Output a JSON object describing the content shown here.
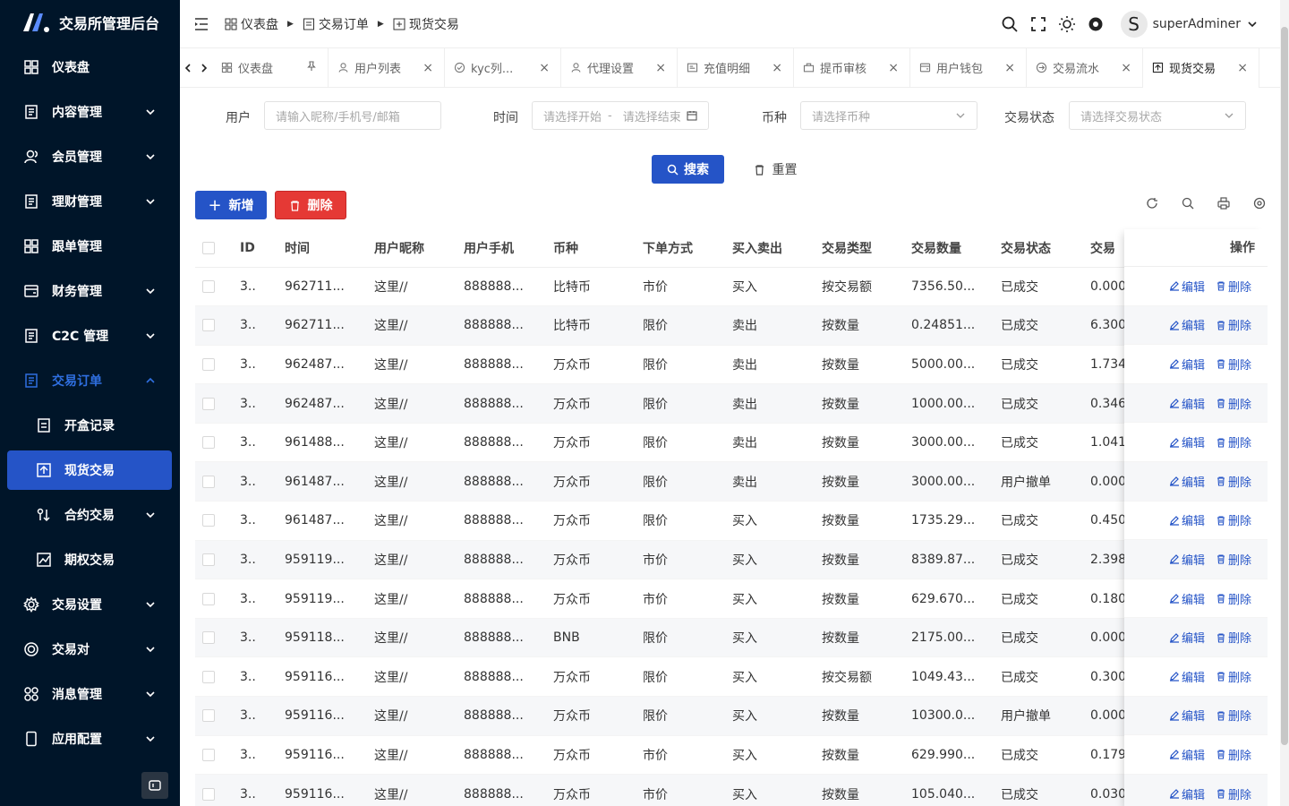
{
  "app": {
    "title": "交易所管理后台"
  },
  "sidebar": {
    "items": [
      {
        "label": "仪表盘",
        "icon": "dashboard-icon",
        "has_children": false
      },
      {
        "label": "内容管理",
        "icon": "document-icon",
        "has_children": true
      },
      {
        "label": "会员管理",
        "icon": "users-icon",
        "has_children": true
      },
      {
        "label": "理财管理",
        "icon": "document-icon",
        "has_children": true
      },
      {
        "label": "跟单管理",
        "icon": "grid-icon",
        "has_children": false
      },
      {
        "label": "财务管理",
        "icon": "wallet-icon",
        "has_children": true
      },
      {
        "label": "C2C 管理",
        "icon": "document-icon",
        "has_children": true
      },
      {
        "label": "交易订单",
        "icon": "order-icon",
        "has_children": true,
        "open": true
      },
      {
        "label": "开盒记录",
        "icon": "list-icon",
        "sub": true
      },
      {
        "label": "现货交易",
        "icon": "spot-icon",
        "sub": true,
        "active": true
      },
      {
        "label": "合约交易",
        "icon": "contract-icon",
        "sub": true,
        "has_children": true
      },
      {
        "label": "期权交易",
        "icon": "chart-icon",
        "sub": true
      },
      {
        "label": "交易设置",
        "icon": "gear-icon",
        "has_children": true
      },
      {
        "label": "交易对",
        "icon": "coin-icon",
        "has_children": true
      },
      {
        "label": "消息管理",
        "icon": "apps-icon",
        "has_children": true
      },
      {
        "label": "应用配置",
        "icon": "phone-icon",
        "has_children": true
      }
    ]
  },
  "breadcrumb": [
    "仪表盘",
    "交易订单",
    "现货交易"
  ],
  "header": {
    "user_initial": "S",
    "user_name": "superAdminer"
  },
  "tabs": [
    {
      "label": "仪表盘",
      "icon": "dashboard-icon",
      "pinned": true
    },
    {
      "label": "用户列表",
      "icon": "user-icon"
    },
    {
      "label": "kyc列...",
      "icon": "check-circle-icon"
    },
    {
      "label": "代理设置",
      "icon": "user-icon"
    },
    {
      "label": "充值明细",
      "icon": "receipt-icon"
    },
    {
      "label": "提币审核",
      "icon": "audit-icon"
    },
    {
      "label": "用户钱包",
      "icon": "wallet-icon"
    },
    {
      "label": "交易流水",
      "icon": "flow-icon"
    },
    {
      "label": "现货交易",
      "icon": "spot-icon",
      "active": true
    }
  ],
  "filters": {
    "user_label": "用户",
    "user_placeholder": "请输入昵称/手机号/邮箱",
    "time_label": "时间",
    "time_start_placeholder": "请选择开始",
    "time_sep": "-",
    "time_end_placeholder": "请选择结束",
    "coin_label": "币种",
    "coin_placeholder": "请选择币种",
    "status_label": "交易状态",
    "status_placeholder": "请选择交易状态",
    "search_btn": "搜索",
    "reset_btn": "重置"
  },
  "toolbar": {
    "add_btn": "新增",
    "delete_btn": "删除"
  },
  "table": {
    "columns": [
      "ID",
      "时间",
      "用户昵称",
      "用户手机",
      "币种",
      "下单方式",
      "买入卖出",
      "交易类型",
      "交易数量",
      "交易状态",
      "交易"
    ],
    "ops_header": "操作",
    "edit_label": "编辑",
    "delete_label": "删除",
    "rows": [
      [
        "3..",
        "962711...",
        "这里//",
        "888888...",
        "比特币",
        "市价",
        "买入",
        "按交易额",
        "7356.50...",
        "已成交",
        "0.000"
      ],
      [
        "3..",
        "962711...",
        "这里//",
        "888888...",
        "比特币",
        "限价",
        "卖出",
        "按数量",
        "0.24851...",
        "已成交",
        "6.300"
      ],
      [
        "3..",
        "962487...",
        "这里//",
        "888888...",
        "万众币",
        "限价",
        "卖出",
        "按数量",
        "5000.00...",
        "已成交",
        "1.734"
      ],
      [
        "3..",
        "962487...",
        "这里//",
        "888888...",
        "万众币",
        "限价",
        "卖出",
        "按数量",
        "1000.00...",
        "已成交",
        "0.346"
      ],
      [
        "3..",
        "961488...",
        "这里//",
        "888888...",
        "万众币",
        "限价",
        "卖出",
        "按数量",
        "3000.00...",
        "已成交",
        "1.041"
      ],
      [
        "3..",
        "961487...",
        "这里//",
        "888888...",
        "万众币",
        "限价",
        "卖出",
        "按数量",
        "3000.00...",
        "用户撤单",
        "0.000"
      ],
      [
        "3..",
        "961487...",
        "这里//",
        "888888...",
        "万众币",
        "限价",
        "买入",
        "按数量",
        "1735.29...",
        "已成交",
        "0.450"
      ],
      [
        "3..",
        "959119...",
        "这里//",
        "888888...",
        "万众币",
        "市价",
        "买入",
        "按数量",
        "8389.87...",
        "已成交",
        "2.398"
      ],
      [
        "3..",
        "959119...",
        "这里//",
        "888888...",
        "万众币",
        "市价",
        "买入",
        "按数量",
        "629.670...",
        "已成交",
        "0.180"
      ],
      [
        "3..",
        "959118...",
        "这里//",
        "888888...",
        "BNB",
        "限价",
        "买入",
        "按数量",
        "2175.00...",
        "已成交",
        "0.000"
      ],
      [
        "3..",
        "959116...",
        "这里//",
        "888888...",
        "万众币",
        "限价",
        "买入",
        "按交易额",
        "1049.43...",
        "已成交",
        "0.300"
      ],
      [
        "3..",
        "959116...",
        "这里//",
        "888888...",
        "万众币",
        "限价",
        "买入",
        "按数量",
        "10300.0...",
        "用户撤单",
        "0.000"
      ],
      [
        "3..",
        "959116...",
        "这里//",
        "888888...",
        "万众币",
        "市价",
        "买入",
        "按数量",
        "629.990...",
        "已成交",
        "0.179"
      ],
      [
        "3..",
        "959116...",
        "这里//",
        "888888...",
        "万众币",
        "市价",
        "买入",
        "按数量",
        "105.040...",
        "已成交",
        "0.030"
      ]
    ]
  },
  "colors": {
    "primary": "#2554c7",
    "danger": "#e53935",
    "sidebar_bg": "#001529"
  }
}
